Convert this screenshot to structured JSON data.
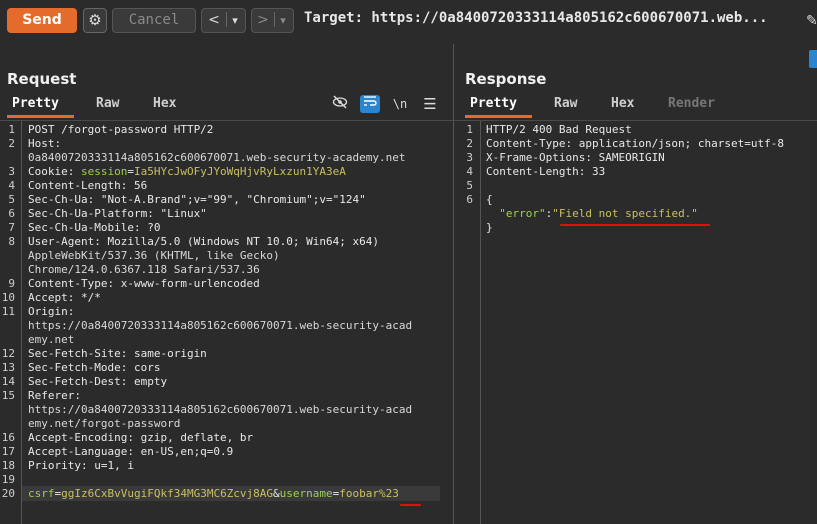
{
  "toolbar": {
    "send_label": "Send",
    "cancel_label": "Cancel",
    "back_glyph": "<",
    "forward_glyph": ">",
    "dropdown_glyph": "▾",
    "target_text": "Target: https://0a8400720333114a805162c600670071.web..."
  },
  "request": {
    "title": "Request",
    "tabs": [
      "Pretty",
      "Raw",
      "Hex"
    ],
    "lines": [
      {
        "n": "1",
        "segs": [
          {
            "t": "POST /forgot-password HTTP/2",
            "c": "k"
          }
        ]
      },
      {
        "n": "2",
        "segs": [
          {
            "t": "Host:",
            "c": "k"
          }
        ]
      },
      {
        "n": "",
        "segs": [
          {
            "t": "0a8400720333114a805162c600670071.web-security-academy.net",
            "c": "v"
          }
        ]
      },
      {
        "n": "3",
        "segs": [
          {
            "t": "Cookie: ",
            "c": "k"
          },
          {
            "t": "session",
            "c": "g"
          },
          {
            "t": "=",
            "c": "k"
          },
          {
            "t": "Ia5HYcJwOFyJYoWqHjvRyLxzun1YA3eA",
            "c": "y"
          }
        ]
      },
      {
        "n": "4",
        "segs": [
          {
            "t": "Content-Length: 56",
            "c": "k"
          }
        ]
      },
      {
        "n": "5",
        "segs": [
          {
            "t": "Sec-Ch-Ua: \"Not-A.Brand\";v=\"99\", \"Chromium\";v=\"124\"",
            "c": "k"
          }
        ]
      },
      {
        "n": "6",
        "segs": [
          {
            "t": "Sec-Ch-Ua-Platform: \"Linux\"",
            "c": "k"
          }
        ]
      },
      {
        "n": "7",
        "segs": [
          {
            "t": "Sec-Ch-Ua-Mobile: ?0",
            "c": "k"
          }
        ]
      },
      {
        "n": "8",
        "segs": [
          {
            "t": "User-Agent: Mozilla/5.0 (Windows NT 10.0; Win64; x64)",
            "c": "k"
          }
        ]
      },
      {
        "n": "",
        "segs": [
          {
            "t": "AppleWebKit/537.36 (KHTML, like Gecko)",
            "c": "v"
          }
        ]
      },
      {
        "n": "",
        "segs": [
          {
            "t": "Chrome/124.0.6367.118 Safari/537.36",
            "c": "v"
          }
        ]
      },
      {
        "n": "9",
        "segs": [
          {
            "t": "Content-Type: x-www-form-urlencoded",
            "c": "k"
          }
        ]
      },
      {
        "n": "10",
        "segs": [
          {
            "t": "Accept: */*",
            "c": "k"
          }
        ]
      },
      {
        "n": "11",
        "segs": [
          {
            "t": "Origin:",
            "c": "k"
          }
        ]
      },
      {
        "n": "",
        "segs": [
          {
            "t": "https://0a8400720333114a805162c600670071.web-security-acad",
            "c": "v"
          }
        ]
      },
      {
        "n": "",
        "segs": [
          {
            "t": "emy.net",
            "c": "v"
          }
        ]
      },
      {
        "n": "12",
        "segs": [
          {
            "t": "Sec-Fetch-Site: same-origin",
            "c": "k"
          }
        ]
      },
      {
        "n": "13",
        "segs": [
          {
            "t": "Sec-Fetch-Mode: cors",
            "c": "k"
          }
        ]
      },
      {
        "n": "14",
        "segs": [
          {
            "t": "Sec-Fetch-Dest: empty",
            "c": "k"
          }
        ]
      },
      {
        "n": "15",
        "segs": [
          {
            "t": "Referer:",
            "c": "k"
          }
        ]
      },
      {
        "n": "",
        "segs": [
          {
            "t": "https://0a8400720333114a805162c600670071.web-security-acad",
            "c": "v"
          }
        ]
      },
      {
        "n": "",
        "segs": [
          {
            "t": "emy.net/forgot-password",
            "c": "v"
          }
        ]
      },
      {
        "n": "16",
        "segs": [
          {
            "t": "Accept-Encoding: gzip, deflate, br",
            "c": "k"
          }
        ]
      },
      {
        "n": "17",
        "segs": [
          {
            "t": "Accept-Language: en-US,en;q=0.9",
            "c": "k"
          }
        ]
      },
      {
        "n": "18",
        "segs": [
          {
            "t": "Priority: u=1, i",
            "c": "k"
          }
        ]
      },
      {
        "n": "19",
        "segs": []
      },
      {
        "n": "20",
        "segs": [
          {
            "t": "csrf",
            "c": "g"
          },
          {
            "t": "=",
            "c": "k"
          },
          {
            "t": "ggIz6CxBvVugiFQkf34MG3MC6Zcvj8AG",
            "c": "y"
          },
          {
            "t": "&",
            "c": "k"
          },
          {
            "t": "username",
            "c": "g"
          },
          {
            "t": "=",
            "c": "k"
          },
          {
            "t": "foobar%23",
            "c": "y"
          }
        ]
      }
    ]
  },
  "response": {
    "title": "Response",
    "tabs": [
      "Pretty",
      "Raw",
      "Hex",
      "Render"
    ],
    "lines": [
      {
        "n": "1",
        "segs": [
          {
            "t": "HTTP/2 400 Bad Request",
            "c": "k"
          }
        ]
      },
      {
        "n": "2",
        "segs": [
          {
            "t": "Content-Type: application/json; charset=utf-8",
            "c": "k"
          }
        ]
      },
      {
        "n": "3",
        "segs": [
          {
            "t": "X-Frame-Options: SAMEORIGIN",
            "c": "k"
          }
        ]
      },
      {
        "n": "4",
        "segs": [
          {
            "t": "Content-Length: 33",
            "c": "k"
          }
        ]
      },
      {
        "n": "5",
        "segs": []
      },
      {
        "n": "6",
        "segs": [
          {
            "t": "{",
            "c": "k"
          }
        ]
      },
      {
        "n": "",
        "segs": [
          {
            "t": "  \"error\"",
            "c": "g"
          },
          {
            "t": ":",
            "c": "k"
          },
          {
            "t": "\"Field not specified.\"",
            "c": "y"
          }
        ]
      },
      {
        "n": "",
        "segs": [
          {
            "t": "}",
            "c": "k"
          }
        ]
      }
    ]
  },
  "icons": {
    "settings": "gear-icon",
    "hide": "eye-slash-icon",
    "wrap": "wrap-lines-icon",
    "newline": "newline-icon",
    "menu": "hamburger-menu-icon",
    "edit": "pencil-icon"
  },
  "colors": {
    "send": "#e46b2c",
    "tab_underline": "#e46b2c",
    "highlight_blue": "#2a86d0",
    "annotation_red": "#d11111"
  }
}
